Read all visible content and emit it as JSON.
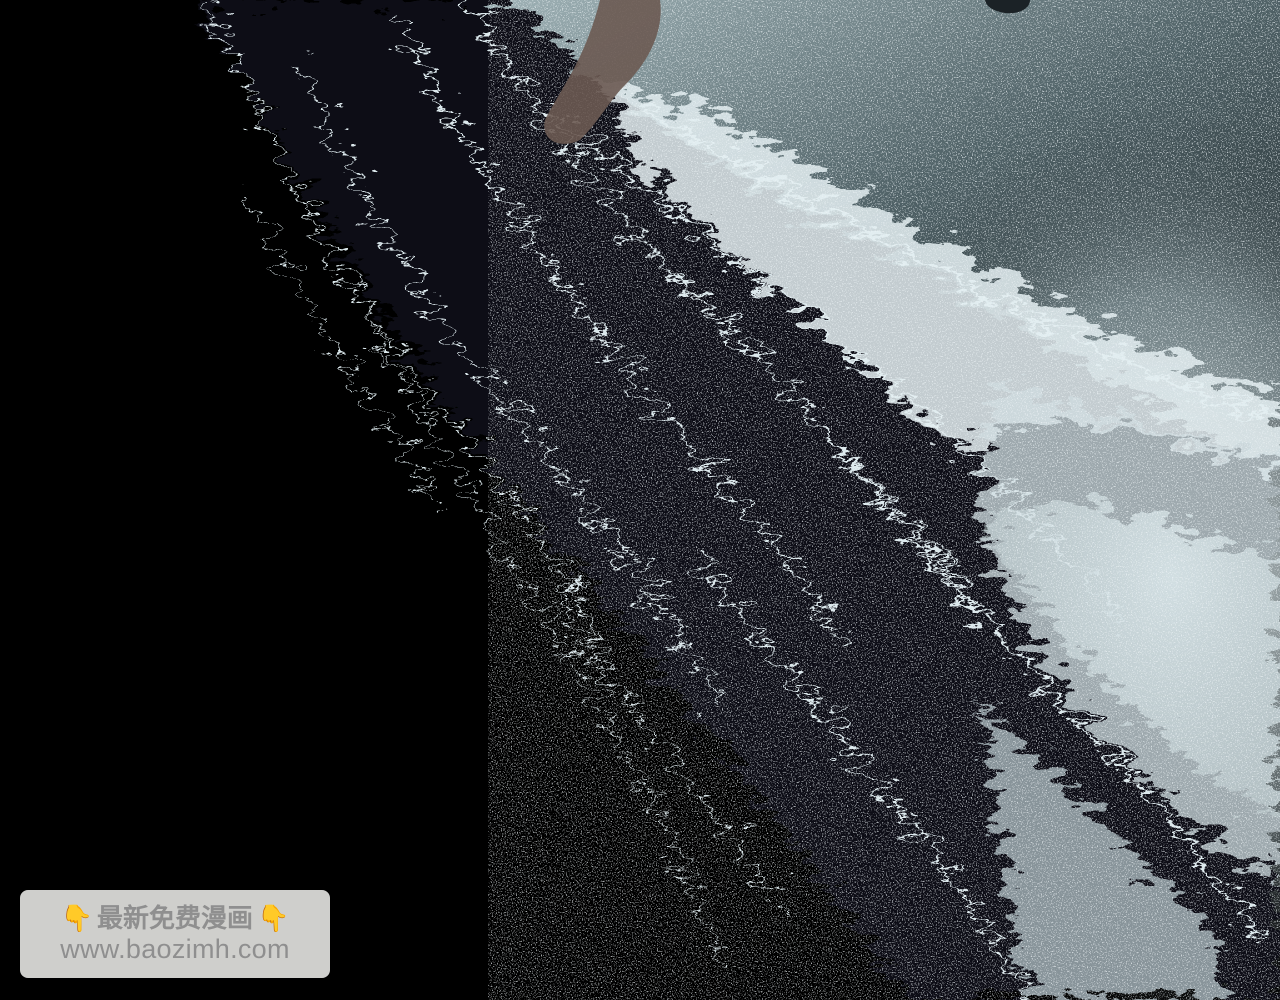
{
  "image": {
    "description_colors": {
      "background": "#000000",
      "spray": "#d8e6ea",
      "mist": "#8fa3a8",
      "skin": "#6b5a52"
    }
  },
  "watermark": {
    "left_icon": "hand-pointing-down-icon",
    "left_glyph": "👇",
    "title": "最新免费漫画",
    "right_icon": "hand-pointing-down-icon",
    "right_glyph": "👇",
    "url": "www.baozimh.com"
  }
}
